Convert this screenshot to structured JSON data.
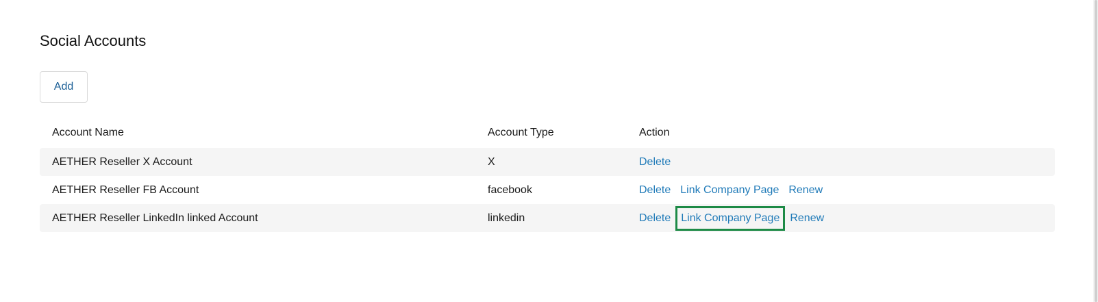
{
  "page": {
    "title": "Social Accounts"
  },
  "toolbar": {
    "add_label": "Add"
  },
  "table": {
    "headers": {
      "name": "Account Name",
      "type": "Account Type",
      "action": "Action"
    },
    "rows": [
      {
        "name": "AETHER Reseller X Account",
        "type": "X",
        "actions": [
          "Delete"
        ]
      },
      {
        "name": "AETHER Reseller FB Account",
        "type": "facebook",
        "actions": [
          "Delete",
          "Link Company Page",
          "Renew"
        ]
      },
      {
        "name": "AETHER Reseller LinkedIn linked Account",
        "type": "linkedin",
        "actions": [
          "Delete",
          "Link Company Page",
          "Renew"
        ]
      }
    ]
  },
  "colors": {
    "link": "#1f7ab8",
    "add_text": "#1b5f96",
    "row_shade": "#f5f5f5",
    "highlight_border": "#1d8a46"
  }
}
